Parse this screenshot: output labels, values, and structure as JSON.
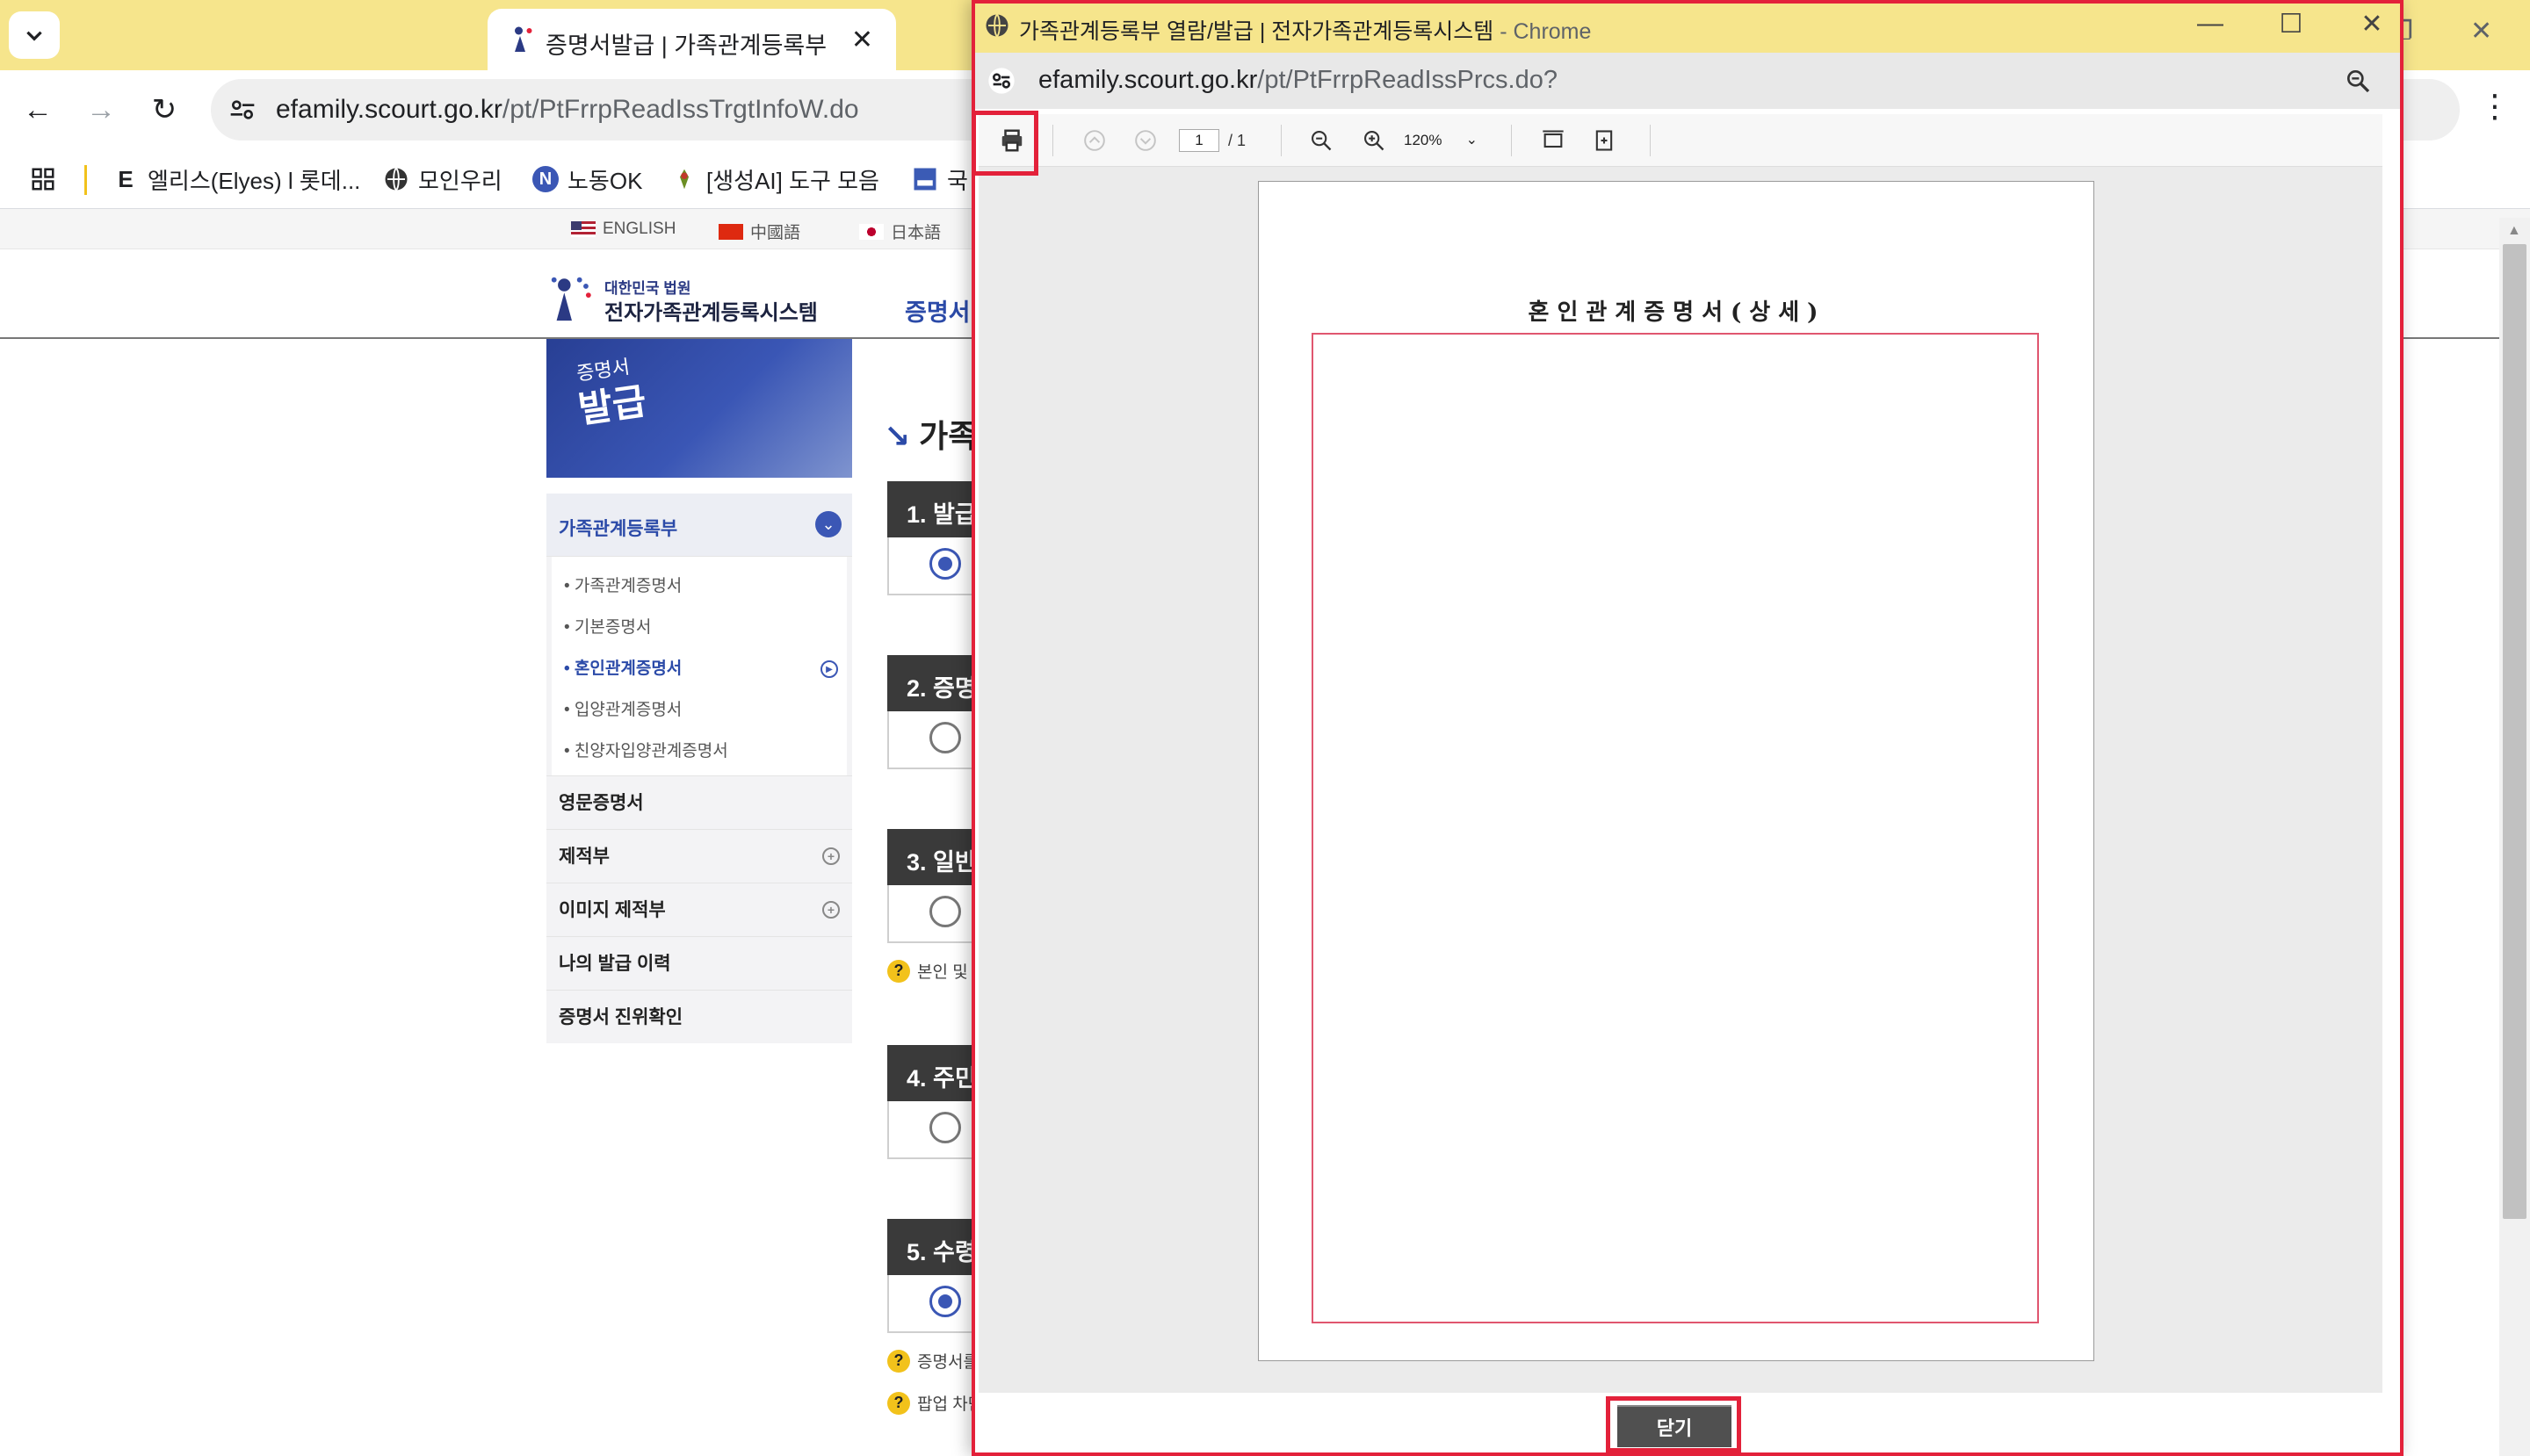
{
  "browser": {
    "tab_title": "증명서발급 | 가족관계등록부 |",
    "tab_close": "✕",
    "url_host": "efamily.scourt.go.kr",
    "url_path": "/pt/PtFrrpReadIssTrgtInfoW.do",
    "bookmarks": [
      {
        "icon": "E",
        "label": "엘리스(Elyes) l 롯데..."
      },
      {
        "icon": "globe-icon",
        "label": "모인우리"
      },
      {
        "icon": "N",
        "label": "노동OK"
      },
      {
        "icon": "tool-icon",
        "label": "[생성AI] 도구 모음"
      },
      {
        "icon": "site-icon",
        "label": "국"
      }
    ]
  },
  "site": {
    "languages": [
      "ENGLISH",
      "中國語",
      "日本語"
    ],
    "logo_small": "대한민국 법원",
    "logo_big": "전자가족관계등록시스템",
    "nav_label": "증명서",
    "banner_small": "증명서",
    "banner_big": "발급",
    "menu_head": "가족관계등록부",
    "sub_items": [
      "• 가족관계증명서",
      "• 기본증명서",
      "• 혼인관계증명서",
      "• 입양관계증명서",
      "• 친양자입양관계증명서"
    ],
    "side_items": [
      "영문증명서",
      "제적부",
      "이미지 제적부",
      "나의 발급 이력",
      "증명서 진위확인"
    ],
    "content_title": "가족",
    "steps": [
      "1. 발급",
      "2. 증명",
      "3. 일반",
      "4. 주민",
      "5. 수령"
    ],
    "help_texts": [
      "본인 및",
      "증명서를",
      "팝업 차단"
    ]
  },
  "popup": {
    "title": "가족관계등록부 열람/발급 | 전자가족관계등록시스템",
    "title_suffix": " - Chrome",
    "url_host": "efamily.scourt.go.kr",
    "url_path": "/pt/PtFrrpReadIssPrcs.do?",
    "page_current": "1",
    "page_total": "/ 1",
    "zoom": "120%",
    "doc_title": "혼인관계증명서(상세)",
    "close_label": "닫기"
  },
  "colors": {
    "chrome_frame": "#f6e58c",
    "brand_blue": "#2b4aa8",
    "highlight": "#e3213a"
  }
}
